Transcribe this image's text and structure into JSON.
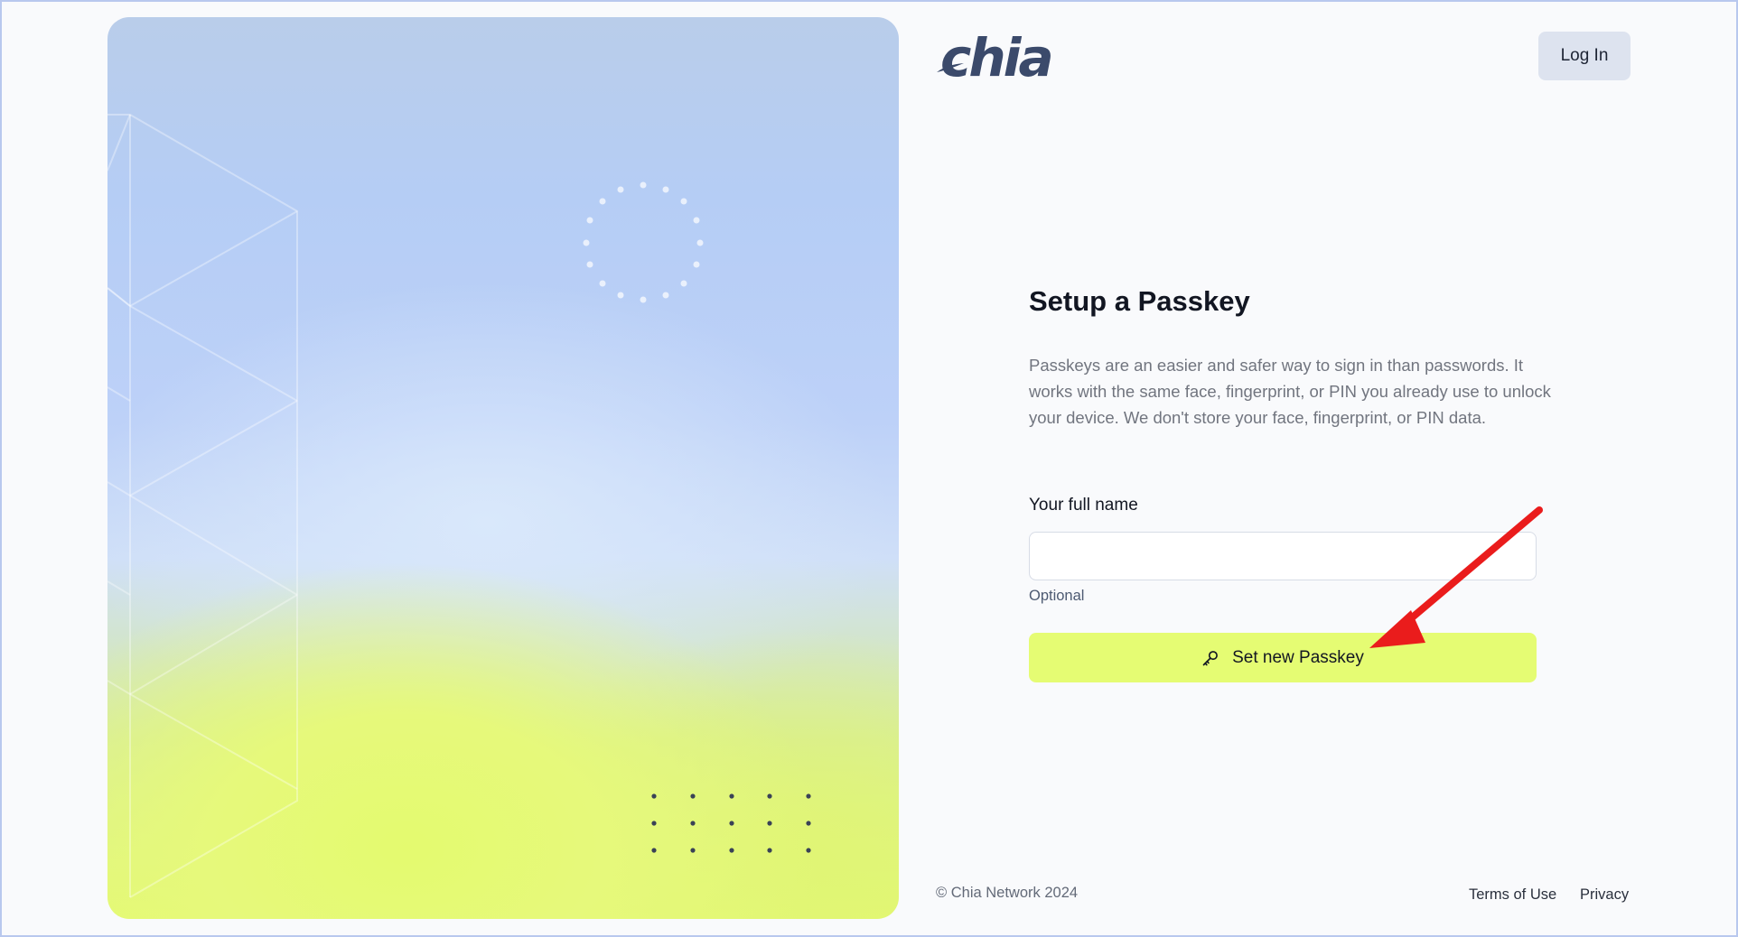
{
  "header": {
    "logo_text": "chia",
    "login_label": "Log In"
  },
  "main": {
    "title": "Setup a Passkey",
    "description": "Passkeys are an easier and safer way to sign in than passwords. It works with the same face, fingerprint, or PIN you already use to unlock your device. We don't store your face, fingerprint, or PIN data.",
    "name_field": {
      "label": "Your full name",
      "value": "",
      "placeholder": "",
      "hint": "Optional"
    },
    "submit_label": "Set new Passkey"
  },
  "footer": {
    "copyright": "© Chia Network 2024",
    "terms_label": "Terms of Use",
    "privacy_label": "Privacy"
  },
  "colors": {
    "accent": "#e5fc73",
    "brand": "#3b4a6b",
    "annotation_arrow": "#ea1c1c"
  },
  "icons": {
    "submit_icon": "key-icon"
  }
}
